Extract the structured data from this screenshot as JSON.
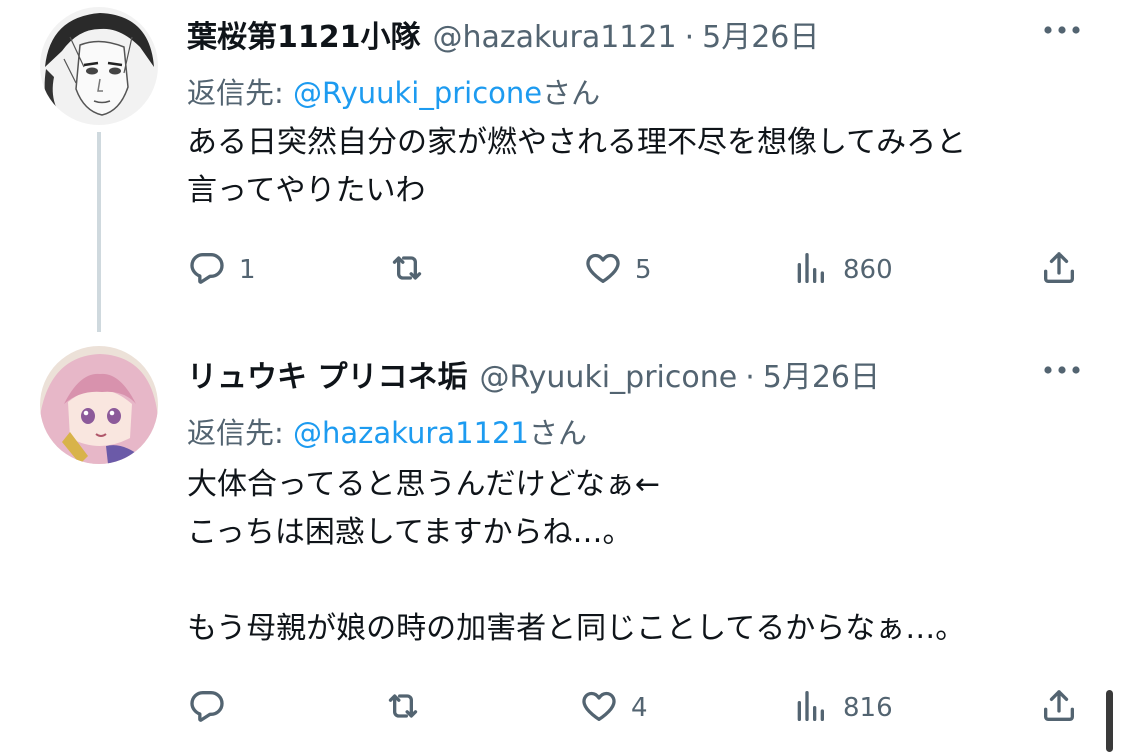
{
  "tweets": [
    {
      "name": "葉桜第1121小隊",
      "handle": "@hazakura1121",
      "dot": "·",
      "date": "5月26日",
      "reply_prefix": "返信先: ",
      "reply_mention": "@Ryuuki_pricone",
      "reply_suffix": "さん",
      "text": "ある日突然自分の家が燃やされる理不尽を想像してみろと\n言ってやりたいわ",
      "replies": "1",
      "retweets": "",
      "likes": "5",
      "views": "860"
    },
    {
      "name": "リュウキ プリコネ垢",
      "handle": "@Ryuuki_pricone",
      "dot": "·",
      "date": "5月26日",
      "reply_prefix": "返信先: ",
      "reply_mention": "@hazakura1121",
      "reply_suffix": "さん",
      "text": "大体合ってると思うんだけどなぁ←\nこっちは困惑してますからね…。\n\nもう母親が娘の時の加害者と同じことしてるからなぁ…。",
      "replies": "",
      "retweets": "",
      "likes": "4",
      "views": "816"
    }
  ],
  "icons": [
    "more-icon",
    "reply-icon",
    "retweet-icon",
    "like-icon",
    "views-icon",
    "share-icon"
  ],
  "colors": {
    "accent": "#1d9bf0",
    "muted": "#536471",
    "text": "#0f1419",
    "thread_line": "#cfd9de"
  }
}
